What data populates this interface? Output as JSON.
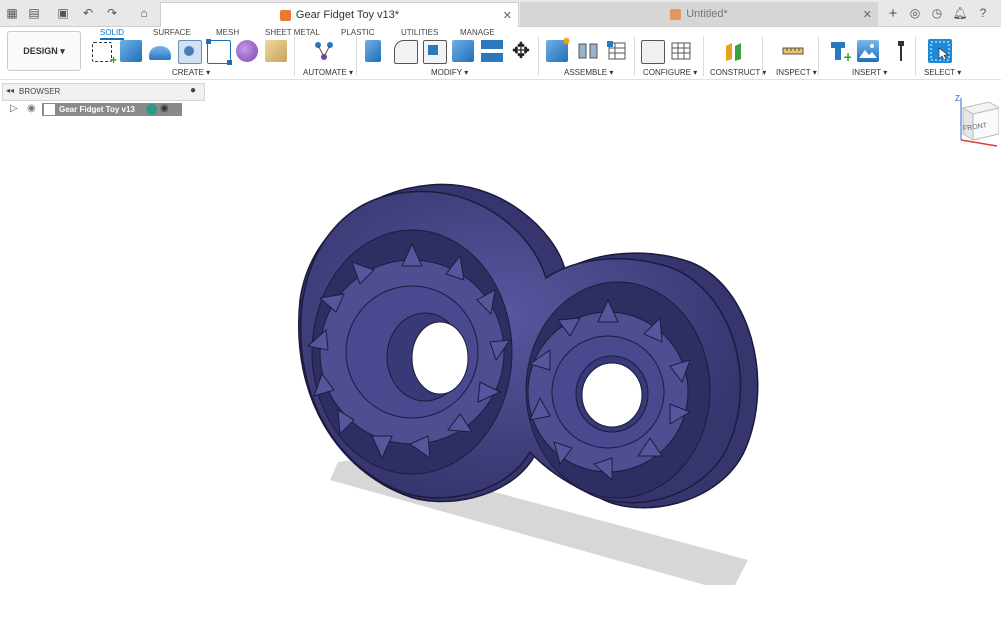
{
  "tabs": [
    {
      "label": "Gear Fidget Toy v13*",
      "active": true
    },
    {
      "label": "Untitled*",
      "active": false
    }
  ],
  "ribbon": {
    "workspace": "DESIGN",
    "tabs": [
      "SOLID",
      "SURFACE",
      "MESH",
      "SHEET METAL",
      "PLASTIC",
      "UTILITIES",
      "MANAGE"
    ],
    "groups": [
      "CREATE",
      "AUTOMATE",
      "MODIFY",
      "ASSEMBLE",
      "CONFIGURE",
      "CONSTRUCT",
      "INSPECT",
      "INSERT",
      "SELECT"
    ]
  },
  "browser": {
    "title": "BROWSER",
    "root": "Gear Fidget Toy v13"
  },
  "viewcube": {
    "face": "FRONT",
    "axis": "Z"
  },
  "colors": {
    "accent": "#0a74c9",
    "model": "#4b4a8c",
    "tab_icon": "#e8792d"
  }
}
